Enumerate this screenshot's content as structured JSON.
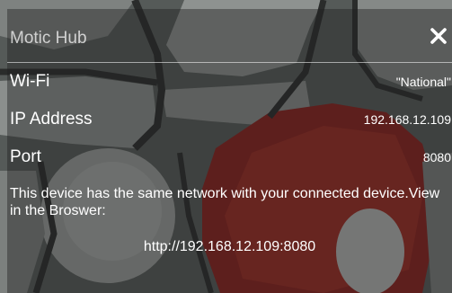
{
  "dialog": {
    "title": "Motic Hub",
    "close_icon": "close-icon"
  },
  "info_rows": [
    {
      "label": "Wi-Fi",
      "value": "\"National\""
    },
    {
      "label": "IP Address",
      "value": "192.168.12.109"
    },
    {
      "label": "Port",
      "value": "8080"
    }
  ],
  "message": "This device has the same network with your connected device.View in the Broswer:",
  "url": "http://192.168.12.109:8080",
  "colors": {
    "overlay": "#1e1e1e",
    "text": "#ffffff",
    "title_text": "#b8b8b8",
    "stain_red": "#8a1f1c"
  }
}
